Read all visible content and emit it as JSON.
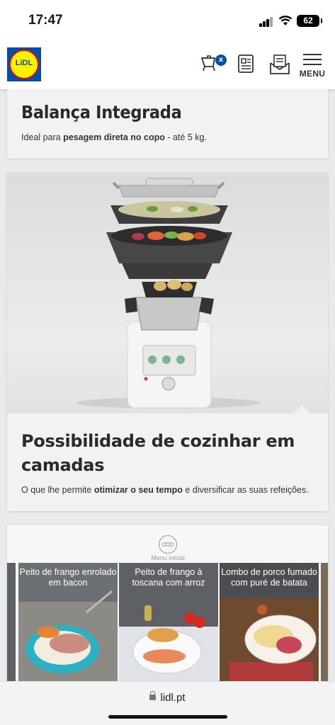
{
  "status_bar": {
    "time": "17:47",
    "battery": "62"
  },
  "header": {
    "logo_text": "LiDL",
    "cart_badge": "x",
    "menu_label": "MENU"
  },
  "cards": [
    {
      "title": "Balança Integrada",
      "desc_pre": "Ideal para ",
      "desc_bold": "pesagem direta no copo",
      "desc_post": " - até 5 kg."
    },
    {
      "title": "Possibilidade de cozinhar em camadas",
      "desc_pre": "O que lhe permite ",
      "desc_bold": "otimizar o seu tempo",
      "desc_post": " e diversificar as suas refeições."
    }
  ],
  "recipes_section": {
    "menu_inicial_label": "Menu inicial",
    "recipes": [
      {
        "title": "Peito de frango enrolado em bacon"
      },
      {
        "title": "Peito de frango à toscana com arroz"
      },
      {
        "title": "Lombo de porco fumado com puré de batata"
      }
    ]
  },
  "browser": {
    "url": "lidl.pt"
  },
  "colors": {
    "brand_blue": "#0050aa",
    "brand_yellow": "#fff100",
    "brand_red": "#e60a14"
  }
}
